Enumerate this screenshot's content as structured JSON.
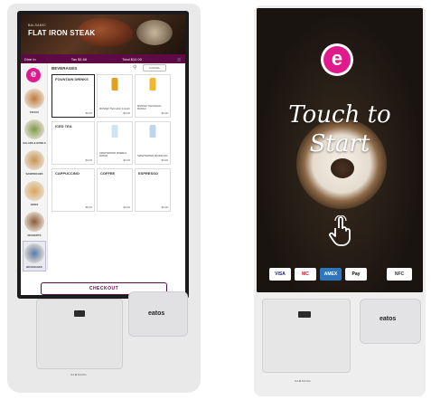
{
  "left_kiosk": {
    "hero": {
      "subtitle": "BALSAMIC",
      "title": "FLAT IRON STEAK"
    },
    "topbar": {
      "dine_in": "Dine In",
      "tax": "Tax $1.66",
      "total": "Total $10.00"
    },
    "categories": [
      {
        "label": "PIZZAS",
        "color": "#c47a3a"
      },
      {
        "label": "SALADS & BOWLS",
        "color": "#7d9a4a"
      },
      {
        "label": "SANDWICHES",
        "color": "#c99350"
      },
      {
        "label": "SIDES",
        "color": "#d9a55a"
      },
      {
        "label": "DESSERTS",
        "color": "#8a5a3a"
      },
      {
        "label": "BEVERAGES",
        "color": "#5a7aa8"
      }
    ],
    "section_title": "BEVERAGES",
    "search_icon": "search-icon",
    "cancel_label": "CANCEL",
    "tiles": [
      {
        "name": "FOUNTAIN DRINKS",
        "price": "$0.00",
        "type": "text"
      },
      {
        "name": "MONKEY TEA HALF & HALF",
        "price": "$4.00",
        "type": "bottle",
        "color": "#e0a21c"
      },
      {
        "name": "MONKEY TEA PEACH MANGO",
        "price": "$4.00",
        "type": "bottle",
        "color": "#f2b730"
      },
      {
        "name": "ICED TEA",
        "price": "$3.00",
        "type": "text"
      },
      {
        "name": "SMARTWATER MINERAL WATER",
        "price": "$3.00",
        "type": "bottle",
        "color": "#cfe3f4"
      },
      {
        "name": "SMARTWATER SPARKLING",
        "price": "$3.00",
        "type": "bottle",
        "color": "#bcd6ee"
      },
      {
        "name": "CAPPUCCINO",
        "price": "$5.00",
        "type": "text"
      },
      {
        "name": "COFFEE",
        "price": "$4.00",
        "type": "text"
      },
      {
        "name": "ESPRESSO",
        "price": "$3.00",
        "type": "text"
      }
    ],
    "checkout_label": "CHECKOUT",
    "brand": "eatos",
    "maker": "SAMSUNG"
  },
  "right_kiosk": {
    "logo_letter": "e",
    "touch_line1": "Touch to",
    "touch_line2": "Start",
    "payments": [
      {
        "label": "VISA",
        "bg": "#ffffff",
        "fg": "#1a1f71"
      },
      {
        "label": "MC",
        "bg": "#ffffff",
        "fg": "#eb001b"
      },
      {
        "label": "AMEX",
        "bg": "#2e77bc",
        "fg": "#ffffff"
      },
      {
        "label": "Pay",
        "bg": "#ffffff",
        "fg": "#000000"
      },
      {
        "label": "NFC",
        "bg": "#ffffff",
        "fg": "#333333"
      }
    ],
    "brand": "eatos",
    "maker": "SAMSUNG"
  },
  "colors": {
    "accent": "#5d0a45",
    "logo": "#e01a8c"
  }
}
